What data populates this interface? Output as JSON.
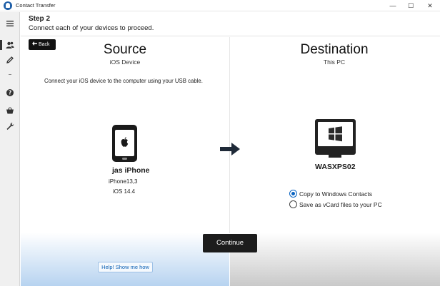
{
  "window": {
    "title": "Contact Transfer",
    "controls": {
      "minimize": "—",
      "maximize": "☐",
      "close": "✕"
    }
  },
  "sidebar": {
    "items": [
      {
        "icon": "hamburger-menu-icon"
      },
      {
        "icon": "contacts-icon"
      },
      {
        "icon": "pencil-icon"
      },
      {
        "icon": "help-icon"
      },
      {
        "icon": "basket-icon"
      },
      {
        "icon": "wrench-icon"
      }
    ]
  },
  "header": {
    "step": "Step 2",
    "instruction": "Connect each of your devices to proceed."
  },
  "back_label": "Back",
  "source": {
    "title": "Source",
    "subtitle": "iOS Device",
    "instructions": "Connect your iOS device to the computer using your USB cable.",
    "device_name": "jas iPhone",
    "device_model": "iPhone13,3",
    "device_os": "iOS 14.4",
    "icon": "iphone-icon"
  },
  "destination": {
    "title": "Destination",
    "subtitle": "This PC",
    "pc_name": "WASXPS02",
    "icon": "windows-pc-icon",
    "options": [
      {
        "label": "Copy to Windows Contacts",
        "selected": true
      },
      {
        "label": "Save as vCard files to your PC",
        "selected": false
      }
    ]
  },
  "continue_label": "Continue",
  "help_label": "Help! Show me how",
  "colors": {
    "accent": "#0a64c2",
    "button_dark": "#1c1c1c",
    "help_gradient": "#b7d3f0"
  }
}
